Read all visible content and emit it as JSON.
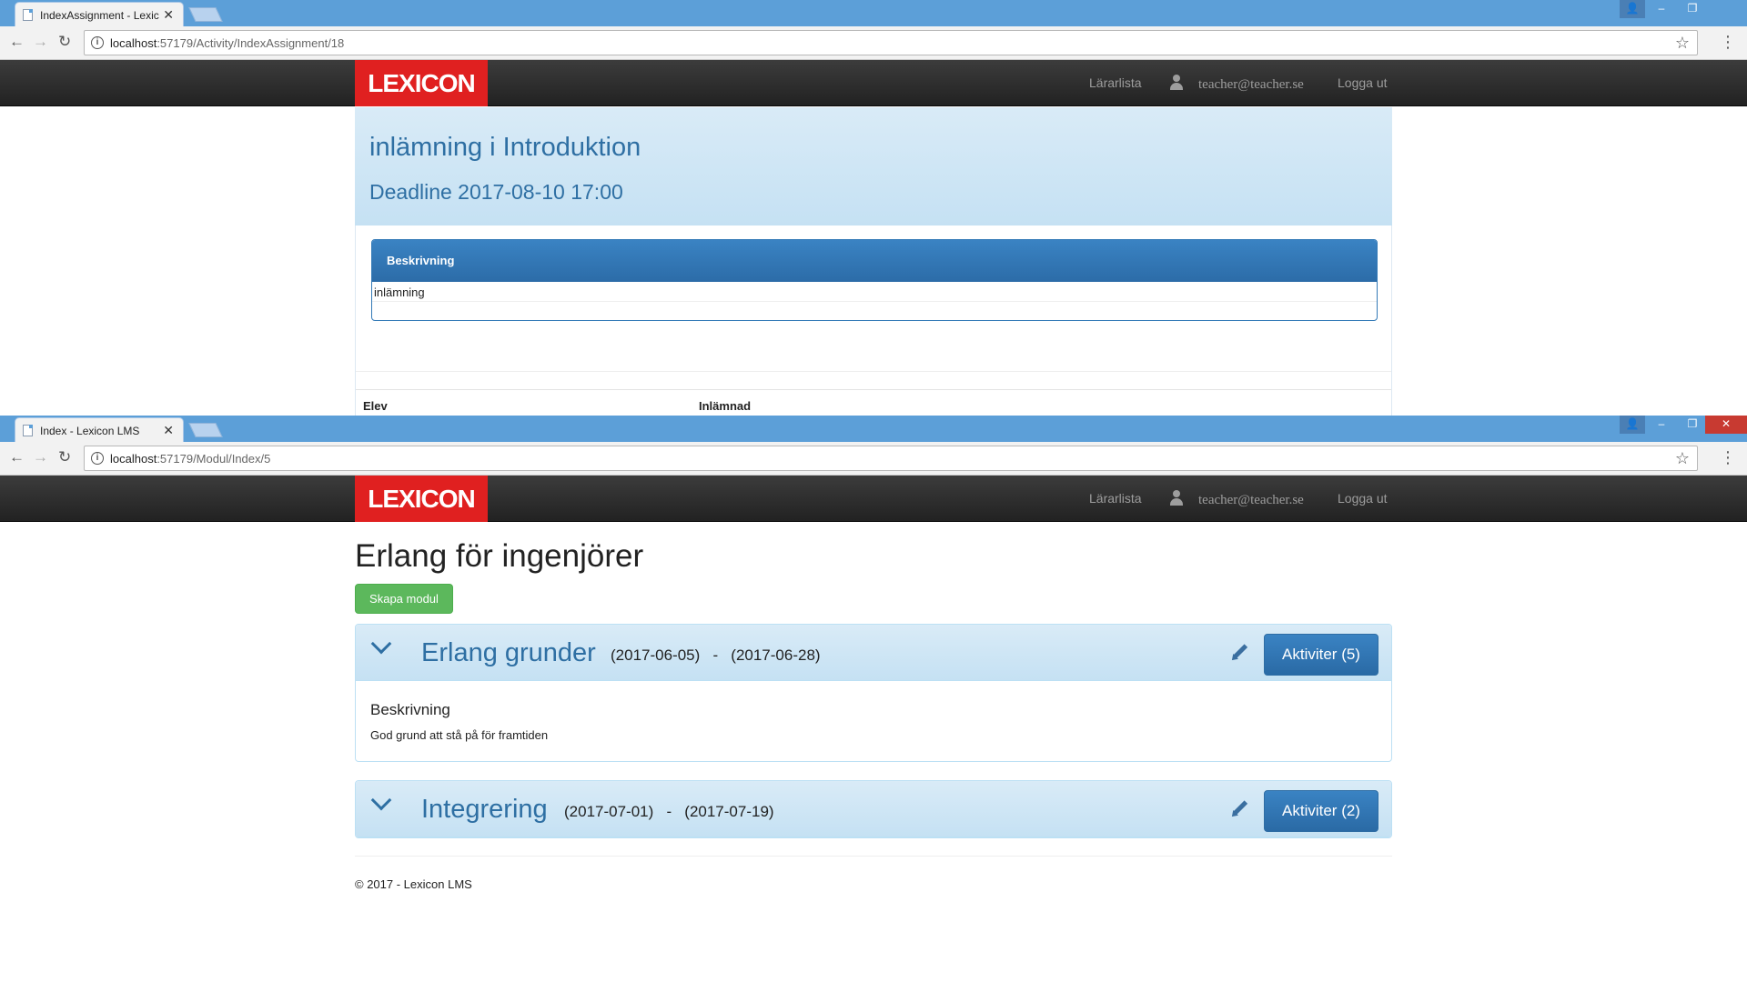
{
  "window1": {
    "tab_title": "IndexAssignment - Lexic",
    "url_host": "localhost",
    "url_rest": ":57179/Activity/IndexAssignment/18",
    "navbar": {
      "logo": "LEXICON",
      "teachers_link": "Lärarlista",
      "email": "teacher@teacher.se",
      "logout": "Logga ut"
    },
    "heading": "inlämning i Introduktion",
    "deadline": "Deadline 2017-08-10 17:00",
    "description_panel": {
      "title": "Beskrivning",
      "text": "inlämning"
    },
    "table_headers": [
      "Elev",
      "Inlämnad"
    ]
  },
  "window2": {
    "tab_title": "Index - Lexicon LMS",
    "url_host": "localhost",
    "url_rest": ":57179/Modul/Index/5",
    "navbar": {
      "logo": "LEXICON",
      "teachers_link": "Lärarlista",
      "email": "teacher@teacher.se",
      "logout": "Logga ut"
    },
    "page_title": "Erlang för ingenjörer",
    "create_button": "Skapa modul",
    "modules": [
      {
        "name": "Erlang grunder",
        "dates": "(2017-06-05)   -   (2017-06-28)",
        "activities_button": "Aktiviter (5)",
        "description_heading": "Beskrivning",
        "description": "God grund att stå på för framtiden"
      },
      {
        "name": "Integrering",
        "dates": "(2017-07-01)   -   (2017-07-19)",
        "activities_button": "Aktiviter (2)"
      }
    ],
    "footer": "© 2017 - Lexicon LMS"
  },
  "colors": {
    "chrome_frame": "#5c9fd8",
    "navbar": "#222222",
    "logo_red": "#e02020",
    "primary": "#337ab7",
    "success": "#5cb85c",
    "panel_info": "#d9ebf7"
  },
  "icons": [
    "back-arrow-icon",
    "forward-arrow-icon",
    "reload-icon",
    "info-icon",
    "star-icon",
    "menu-dots-icon",
    "user-icon",
    "chevron-down-icon",
    "pencil-icon",
    "close-icon"
  ]
}
